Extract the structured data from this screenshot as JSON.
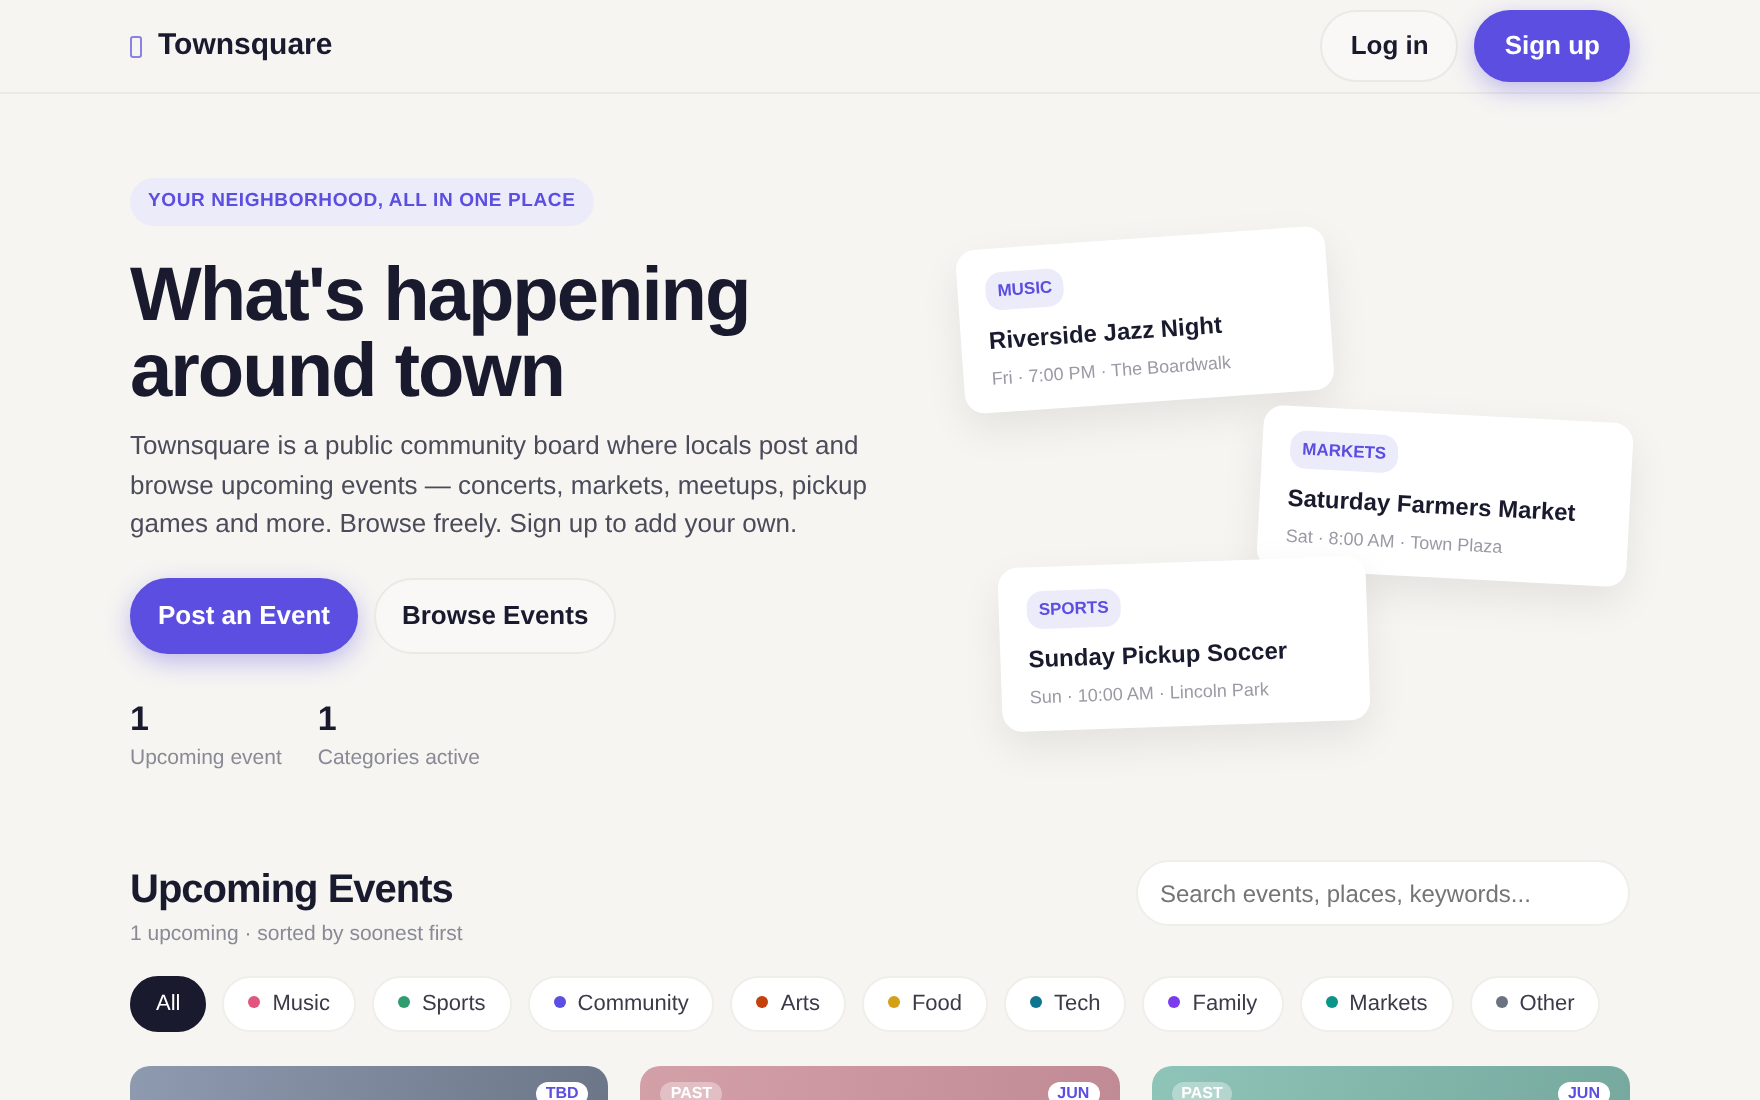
{
  "navbar": {
    "brand": "Townsquare",
    "buttons": [
      {
        "label": "Log in",
        "kind": "ghost"
      },
      {
        "label": "Sign up",
        "kind": "primary"
      }
    ]
  },
  "hero": {
    "eyebrow": "YOUR NEIGHBORHOOD, ALL IN ONE PLACE",
    "title": "What's happening around town",
    "lead": "Townsquare is a public community board where locals post and browse upcoming events — concerts, markets, meetups, pickup games and more. Browse freely. Sign up to add your own.",
    "buttons": [
      {
        "label": "Post an Event",
        "kind": "primary"
      },
      {
        "label": "Browse Events",
        "kind": "ghost"
      }
    ],
    "stats": [
      {
        "value": "1",
        "label": "Upcoming event"
      },
      {
        "value": "1",
        "label": "Categories active"
      }
    ],
    "preview_cards": [
      {
        "tag": "MUSIC",
        "title": "Riverside Jazz Night",
        "meta": "Fri · 7:00 PM · The Boardwalk"
      },
      {
        "tag": "MARKETS",
        "title": "Saturday Farmers Market",
        "meta": "Sat · 8:00 AM · Town Plaza"
      },
      {
        "tag": "SPORTS",
        "title": "Sunday Pickup Soccer",
        "meta": "Sun · 10:00 AM · Lincoln Park"
      }
    ]
  },
  "events": {
    "title": "Upcoming Events",
    "subtitle": "1 upcoming · sorted by soonest first",
    "search": {
      "placeholder": "Search events, places, keywords..."
    },
    "filters": [
      {
        "label": "All",
        "selected": true
      },
      {
        "label": "Music",
        "selected": false,
        "color": "#e0567f"
      },
      {
        "label": "Sports",
        "selected": false,
        "color": "#2e9c6e"
      },
      {
        "label": "Community",
        "selected": false,
        "color": "#5b4ee0"
      },
      {
        "label": "Arts",
        "selected": false,
        "color": "#c2410c"
      },
      {
        "label": "Food",
        "selected": false,
        "color": "#d4a017"
      },
      {
        "label": "Tech",
        "selected": false,
        "color": "#0e7490"
      },
      {
        "label": "Family",
        "selected": false,
        "color": "#7c3aed"
      },
      {
        "label": "Markets",
        "selected": false,
        "color": "#0d9488"
      },
      {
        "label": "Other",
        "selected": false,
        "color": "#6b7280"
      }
    ],
    "cards": [
      {
        "badges": [
          {
            "text": "TBD",
            "kind": "date"
          }
        ]
      },
      {
        "badges": [
          {
            "text": "PAST",
            "kind": "status"
          },
          {
            "text": "JUN",
            "kind": "date"
          }
        ]
      },
      {
        "badges": [
          {
            "text": "PAST",
            "kind": "status"
          },
          {
            "text": "JUN",
            "kind": "date"
          }
        ]
      }
    ]
  }
}
